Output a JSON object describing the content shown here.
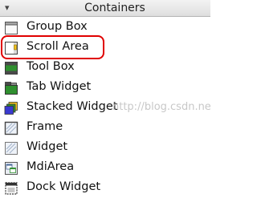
{
  "panel": {
    "title": "Containers",
    "collapse_glyph": "▾"
  },
  "items": [
    {
      "label": "Group Box",
      "icon": "group-box-icon"
    },
    {
      "label": "Scroll Area",
      "icon": "scroll-area-icon"
    },
    {
      "label": "Tool Box",
      "icon": "tool-box-icon"
    },
    {
      "label": "Tab Widget",
      "icon": "tab-widget-icon"
    },
    {
      "label": "Stacked Widget",
      "icon": "stacked-widget-icon"
    },
    {
      "label": "Frame",
      "icon": "frame-icon"
    },
    {
      "label": "Widget",
      "icon": "widget-icon"
    },
    {
      "label": "MdiArea",
      "icon": "mdi-area-icon"
    },
    {
      "label": "Dock Widget",
      "icon": "dock-widget-icon"
    }
  ],
  "annotation": {
    "color": "#e00000"
  },
  "watermark": "http://blog.csdn.net/"
}
